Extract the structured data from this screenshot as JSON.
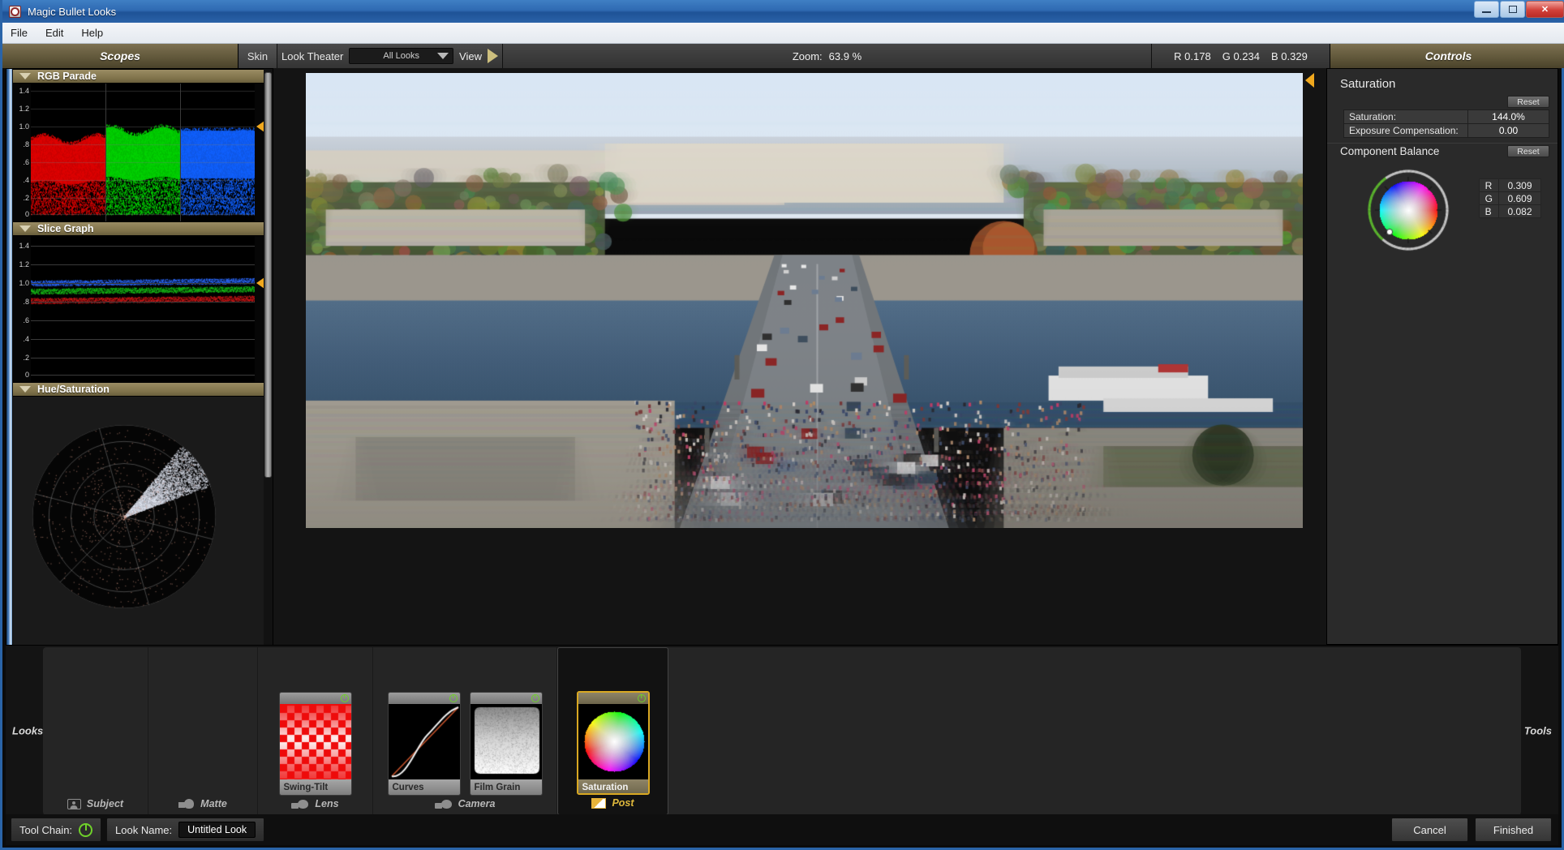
{
  "window": {
    "title": "Magic Bullet Looks",
    "app_icon": "app-icon",
    "buttons": {
      "minimize": "—",
      "maximize": "❐",
      "close": "✕"
    }
  },
  "menu": {
    "items": [
      "File",
      "Edit",
      "Help"
    ]
  },
  "toolbar": {
    "scopes_label": "Scopes",
    "skin_label": "Skin",
    "look_theater_label": "Look Theater",
    "look_filter_value": "All Looks",
    "look_filter_options": [
      "All Looks"
    ],
    "view_label": "View",
    "play_icon": "play-icon",
    "zoom_label": "Zoom:",
    "zoom_value": "63.9 %",
    "rgb_readout": {
      "r": "R  0.178",
      "g": "G  0.234",
      "b": "B  0.329"
    },
    "controls_label": "Controls"
  },
  "scopes": {
    "panels": [
      {
        "title": "RGB Parade",
        "ticks": [
          "1.4",
          "1.2",
          "1.0",
          ".8",
          ".6",
          ".4",
          ".2",
          "0"
        ],
        "marker_value": "1.0"
      },
      {
        "title": "Slice Graph",
        "ticks": [
          "1.4",
          "1.2",
          "1.0",
          ".8",
          ".6",
          ".4",
          ".2",
          "0"
        ],
        "marker_value": "1.0"
      },
      {
        "title": "Hue/Saturation",
        "ticks": [],
        "marker_value": ""
      }
    ]
  },
  "controls": {
    "title": "Saturation",
    "reset_label": "Reset",
    "params": [
      {
        "name": "Saturation:",
        "value": "144.0%"
      },
      {
        "name": "Exposure Compensation:",
        "value": "0.00"
      }
    ],
    "component_balance": {
      "title": "Component Balance",
      "reset_label": "Reset",
      "channels": [
        {
          "label": "R",
          "value": "0.309"
        },
        {
          "label": "G",
          "value": "0.609"
        },
        {
          "label": "B",
          "value": "0.082"
        }
      ]
    }
  },
  "chain": {
    "looks_label": "Looks",
    "tools_label": "Tools",
    "categories": [
      {
        "name": "Subject",
        "icon": "subject-icon",
        "selected": false,
        "tiles": []
      },
      {
        "name": "Matte",
        "icon": "matte-icon",
        "selected": false,
        "tiles": []
      },
      {
        "name": "Lens",
        "icon": "lens-icon",
        "selected": false,
        "tiles": [
          {
            "name": "Swing-Tilt",
            "thumb": "checker-red",
            "enabled": true,
            "active": false
          }
        ]
      },
      {
        "name": "Camera",
        "icon": "camera-icon",
        "selected": false,
        "tiles": [
          {
            "name": "Curves",
            "thumb": "curve",
            "enabled": true,
            "active": false
          },
          {
            "name": "Film Grain",
            "thumb": "grain",
            "enabled": true,
            "active": false
          }
        ]
      },
      {
        "name": "Post",
        "icon": "post-icon",
        "selected": true,
        "tiles": [
          {
            "name": "Saturation",
            "thumb": "colorwheel",
            "enabled": true,
            "active": true
          }
        ]
      }
    ]
  },
  "statusbar": {
    "tool_chain_label": "Tool Chain:",
    "tool_chain_power": "power-icon",
    "look_name_label": "Look Name:",
    "look_name_value": "Untitled Look",
    "cancel_label": "Cancel",
    "finished_label": "Finished"
  },
  "colors": {
    "accent_gold": "#f0a81e",
    "header_gold": "#7e7149",
    "titlebar_blue": "#2f6ab2",
    "power_green": "#6fd12a"
  }
}
